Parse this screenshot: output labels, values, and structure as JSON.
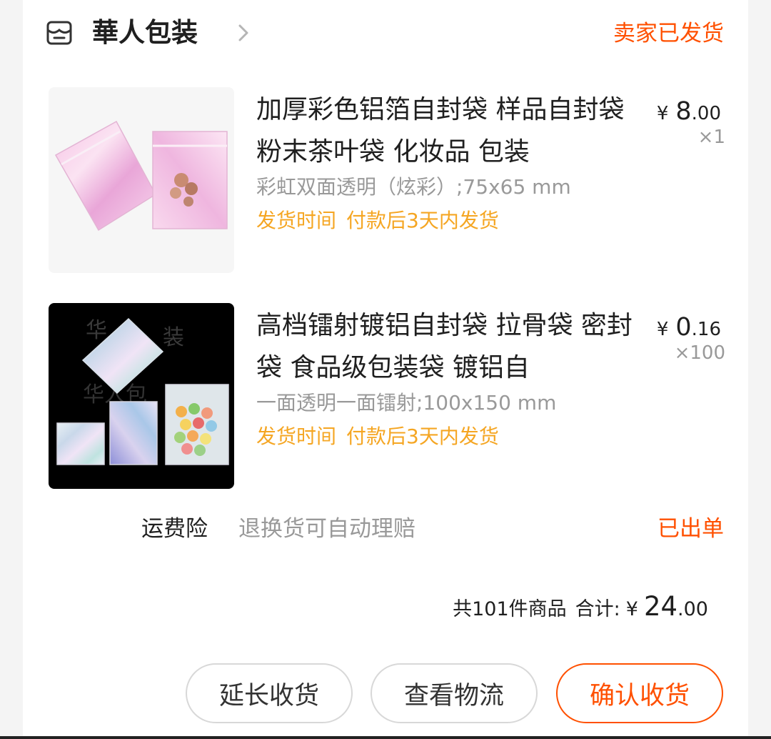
{
  "shop": {
    "name": "華人包装",
    "status": "卖家已发货"
  },
  "items": [
    {
      "title": "加厚彩色铝箔自封袋 样品自封袋 粉末茶叶袋 化妆品 包装",
      "spec": "彩虹双面透明（炫彩）;75x65 mm",
      "ship_label": "发货时间",
      "ship_time": "付款后3天内发货",
      "price_symbol": "¥",
      "price_int": "8",
      "price_dec": ".00",
      "qty": "×1",
      "image": "pink-holographic-bags"
    },
    {
      "title": "高档镭射镀铝自封袋 拉骨袋 密封袋 食品级包装袋 镀铝自",
      "spec": "一面透明一面镭射;100x150 mm",
      "ship_label": "发货时间",
      "ship_time": "付款后3天内发货",
      "price_symbol": "¥",
      "price_int": "0",
      "price_dec": ".16",
      "qty": "×100",
      "image": "silver-holographic-bags",
      "watermark_1": "华",
      "watermark_2": "装",
      "watermark_3": "华人包"
    }
  ],
  "insurance": {
    "label": "运费险",
    "desc": "退换货可自动理赔",
    "status": "已出单"
  },
  "summary": {
    "count": "共101件商品",
    "total_label": "合计:",
    "symbol": "¥",
    "total_int": "24",
    "total_dec": ".00"
  },
  "buttons": {
    "extend": "延长收货",
    "logistics": "查看物流",
    "confirm": "确认收货"
  },
  "colors": {
    "accent": "#ff5000",
    "ship": "#f5a623",
    "muted": "#999999"
  }
}
